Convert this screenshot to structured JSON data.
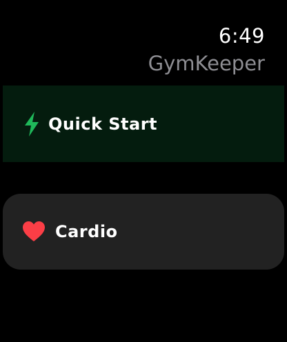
{
  "status": {
    "time": "6:49"
  },
  "header": {
    "title": "GymKeeper"
  },
  "menu": {
    "items": [
      {
        "label": "Quick Start",
        "icon": "bolt-icon",
        "accent": "#1fb85a",
        "background": "#041c0e"
      },
      {
        "label": "Cardio",
        "icon": "heart-icon",
        "accent": "#fb3e46",
        "background": "#222222"
      }
    ]
  }
}
